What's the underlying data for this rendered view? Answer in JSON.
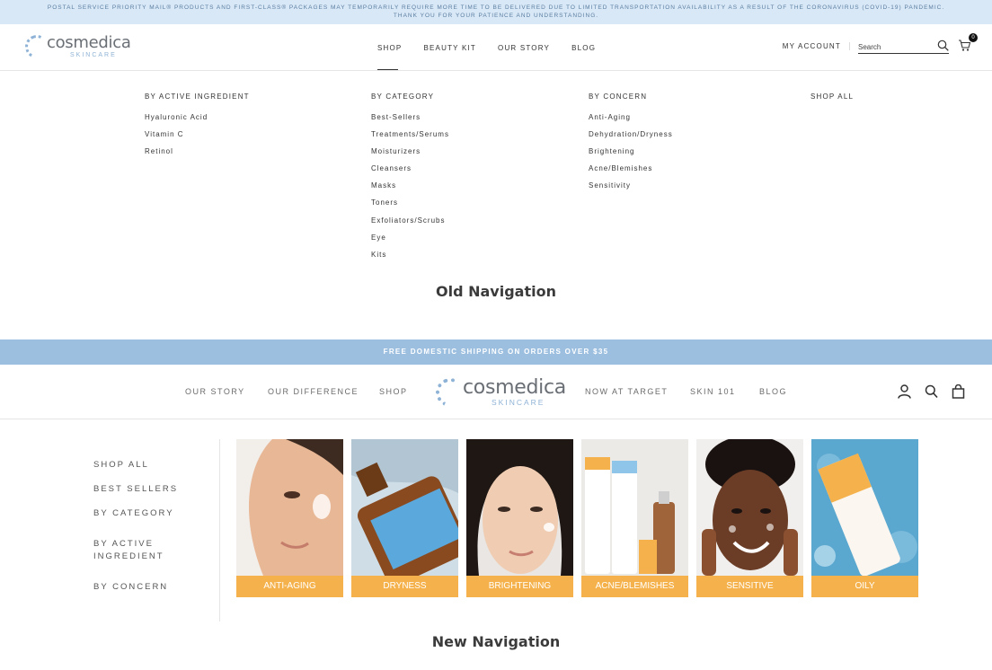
{
  "old": {
    "notice": "POSTAL SERVICE PRIORITY MAIL® PRODUCTS AND FIRST-CLASS® PACKAGES MAY TEMPORARILY REQUIRE MORE TIME TO BE DELIVERED DUE TO LIMITED TRANSPORTATION AVAILABILITY AS A RESULT OF THE CORONAVIRUS (COVID-19) PANDEMIC. THANK YOU FOR YOUR PATIENCE AND UNDERSTANDING.",
    "logo": {
      "brand": "cosmedica",
      "sub": "SKINCARE"
    },
    "menu": [
      "SHOP",
      "BEAUTY KIT",
      "OUR STORY",
      "BLOG"
    ],
    "account": "MY ACCOUNT",
    "search_placeholder": "Search",
    "cart_count": "0",
    "mega": {
      "col1": {
        "heading": "BY ACTIVE INGREDIENT",
        "links": [
          "Hyaluronic Acid",
          "Vitamin C",
          "Retinol"
        ]
      },
      "col2": {
        "heading": "BY CATEGORY",
        "links": [
          "Best-Sellers",
          "Treatments/Serums",
          "Moisturizers",
          "Cleansers",
          "Masks",
          "Toners",
          "Exfoliators/Scrubs",
          "Eye",
          "Kits"
        ]
      },
      "col3": {
        "heading": "BY CONCERN",
        "links": [
          "Anti-Aging",
          "Dehydration/Dryness",
          "Brightening",
          "Acne/Blemishes",
          "Sensitivity"
        ]
      },
      "col4": {
        "heading": "SHOP ALL"
      }
    },
    "caption": "Old Navigation"
  },
  "new": {
    "promo": "FREE DOMESTIC SHIPPING ON ORDERS OVER $35",
    "nav_left": [
      "OUR STORY",
      "OUR DIFFERENCE",
      "SHOP"
    ],
    "logo": {
      "brand": "cosmedica",
      "sub": "SKINCARE"
    },
    "nav_right": [
      "NOW AT TARGET",
      "SKIN 101",
      "BLOG"
    ],
    "sidebar": [
      "SHOP ALL",
      "BEST SELLERS",
      "BY CATEGORY",
      "BY ACTIVE INGREDIENT",
      "BY CONCERN"
    ],
    "tiles": [
      "ANTI-AGING",
      "DRYNESS",
      "BRIGHTENING",
      "ACNE/BLEMISHES",
      "SENSITIVE",
      "OILY"
    ],
    "caption": "New Navigation"
  },
  "colors": {
    "notice_bg": "#d9e8f7",
    "promo_bg": "#9cbfe0",
    "tile_label_bg": "#f5b24c",
    "logo_accent": "#8fb3d6"
  },
  "icons": [
    "search-icon",
    "cart-icon",
    "account-icon"
  ]
}
